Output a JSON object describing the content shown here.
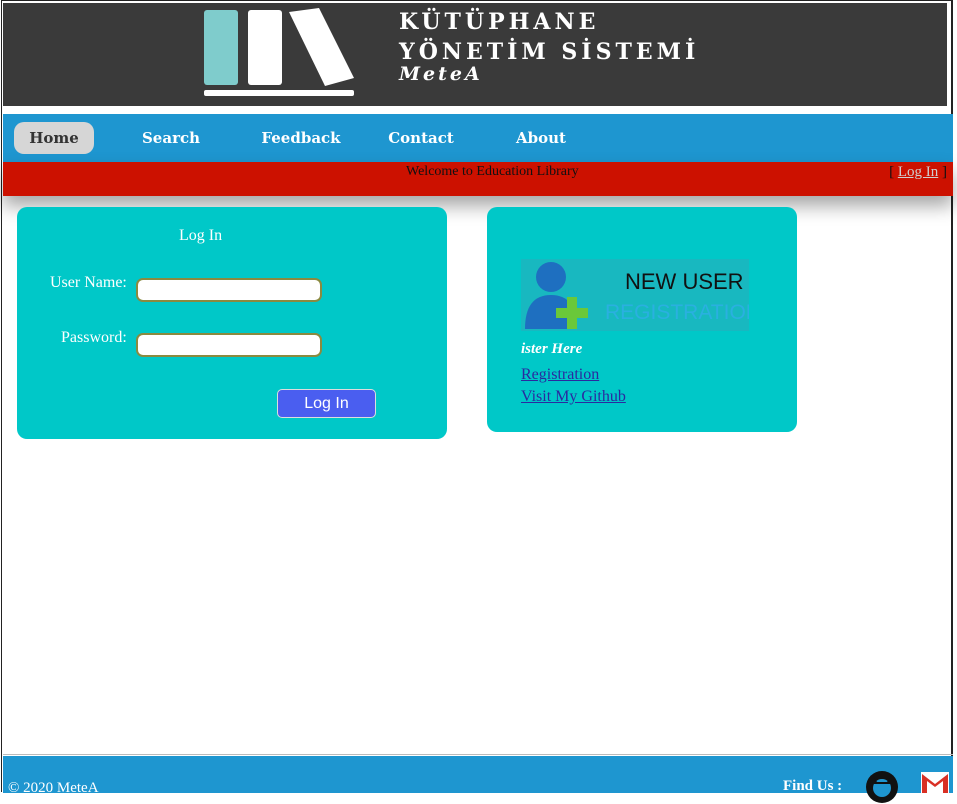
{
  "header": {
    "title_line1": "KÜTÜPHANE",
    "title_line2": "YÖNETİM SİSTEMİ",
    "subtitle": "MeteA"
  },
  "nav": {
    "items": [
      {
        "label": "Home",
        "active": true
      },
      {
        "label": "Search Books"
      },
      {
        "label": "Feedback"
      },
      {
        "label": "Contact Us"
      },
      {
        "label": "About Us"
      }
    ]
  },
  "welcome": {
    "text": "Welcome to Education Library",
    "bracket_open": "[",
    "login_link": "Log In",
    "bracket_close": "]"
  },
  "login_panel": {
    "title": "Log In",
    "username_label": "User Name:",
    "password_label": "Password:",
    "username_value": "",
    "password_value": "",
    "button_label": "Log In"
  },
  "register_panel": {
    "image_text_line1": "NEW USER",
    "image_text_line2": "REGISTRATION",
    "register_here": "ister Here",
    "registration_link": "Registration",
    "github_link": "Visit My Github"
  },
  "footer": {
    "copyright": "© 2020 MeteA",
    "find_us": "Find Us :"
  },
  "colors": {
    "header_bg": "#3a3a3a",
    "nav_bg": "#1e96d0",
    "welcome_bg": "#cc1100",
    "panel_bg": "#00c8c8",
    "button_bg": "#4a5ef0"
  }
}
